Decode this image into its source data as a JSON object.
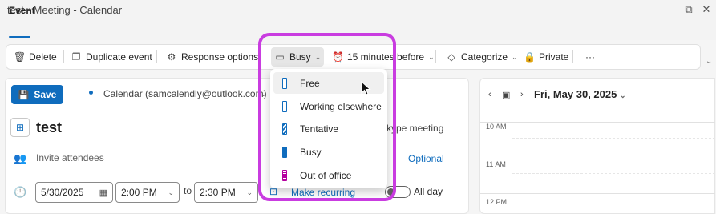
{
  "window": {
    "title": "test - Meeting - Calendar"
  },
  "tabs": {
    "event": "Event"
  },
  "toolbar": {
    "delete": "Delete",
    "duplicate": "Duplicate event",
    "response_options": "Response options",
    "busy": "Busy",
    "reminder": "15 minutes before",
    "categorize": "Categorize",
    "private": "Private",
    "more": "···"
  },
  "form": {
    "save": "Save",
    "calendar": "Calendar (samcalendly@outlook.com)",
    "title": "test",
    "skype": "kype meeting",
    "invite_placeholder": "Invite attendees",
    "optional": "Optional",
    "start_date": "5/30/2025",
    "start_time": "2:00 PM",
    "to": "to",
    "end_time": "2:30 PM",
    "recurring": "Make recurring",
    "all_day": "All day"
  },
  "side_calendar": {
    "date": "Fri, May 30, 2025",
    "times": [
      "10 AM",
      "11 AM",
      "12 PM"
    ]
  },
  "status_menu": {
    "items": [
      {
        "label": "Free",
        "kind": "free"
      },
      {
        "label": "Working elsewhere",
        "kind": "elsewhere"
      },
      {
        "label": "Tentative",
        "kind": "tentative"
      },
      {
        "label": "Busy",
        "kind": "busy"
      },
      {
        "label": "Out of office",
        "kind": "oof"
      }
    ],
    "hovered": "Free"
  },
  "colors": {
    "accent": "#0f6cbd",
    "highlight": "#c93ce0",
    "oof": "#b4009e"
  }
}
